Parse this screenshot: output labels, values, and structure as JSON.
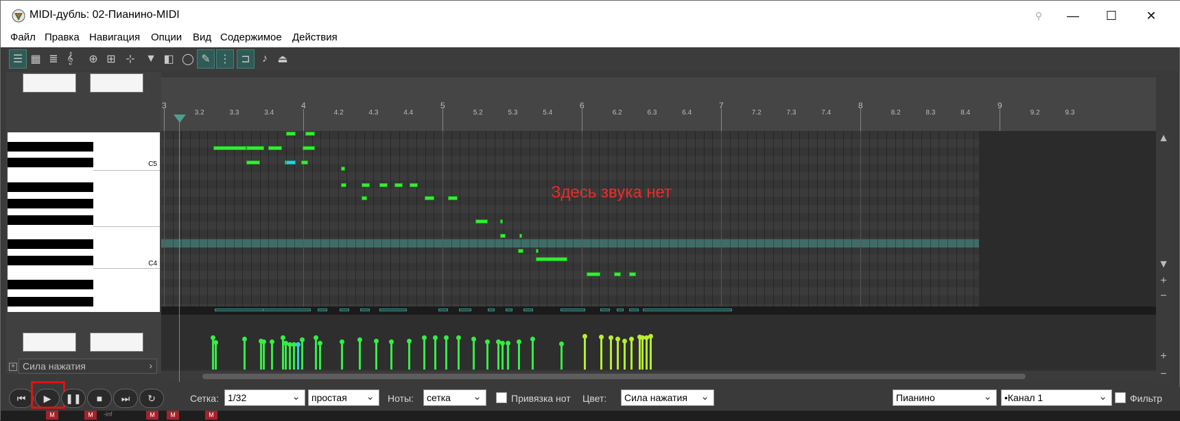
{
  "window": {
    "title": "MIDI-дубль: 02-Пианино-MIDI",
    "pin_icon": "pin-icon",
    "minimize_icon": "minimize-icon",
    "maximize_icon": "maximize-icon",
    "close_icon": "close-icon"
  },
  "menu": [
    {
      "label": "Файл"
    },
    {
      "label": "Правка"
    },
    {
      "label": "Навигация"
    },
    {
      "label": "Опции"
    },
    {
      "label": "Вид"
    },
    {
      "label": "Содержимое"
    },
    {
      "label": "Действия"
    }
  ],
  "toolbar": [
    {
      "icon": "piano-roll-icon",
      "active": true
    },
    {
      "icon": "drum-grid-icon",
      "active": false
    },
    {
      "icon": "event-list-icon",
      "active": false
    },
    {
      "icon": "treble-clef-icon",
      "active": false
    },
    {
      "icon": "insert-cc-icon",
      "active": false
    },
    {
      "icon": "lane-edit-icon",
      "active": false
    },
    {
      "icon": "move-icon",
      "active": false
    },
    {
      "icon": "filter-icon",
      "active": false
    },
    {
      "icon": "panel-toggle-icon",
      "active": false
    },
    {
      "icon": "lasso-icon",
      "active": false
    },
    {
      "icon": "draw-icon",
      "active": true
    },
    {
      "icon": "grid-dots-icon",
      "active": true
    },
    {
      "icon": "snap-icon",
      "active": true
    },
    {
      "icon": "step-input-icon",
      "active": false
    },
    {
      "icon": "record-settings-icon",
      "active": false
    }
  ],
  "keyboard": {
    "c5_label": "C5",
    "c4_label": "C4"
  },
  "velocity_lane": {
    "label": "Сила нажатия"
  },
  "grid": {
    "message": "Здесь звука нет"
  },
  "ruler": {
    "labels": [
      "3",
      "3.2",
      "3.3",
      "3.4",
      "4",
      "4.2",
      "4.3",
      "4.4",
      "5",
      "5.2",
      "5.3",
      "5.4",
      "6",
      "6.2",
      "6.3",
      "6.4",
      "7",
      "7.2",
      "7.3",
      "7.4",
      "8",
      "8.2",
      "8.3",
      "8.4",
      "9",
      "9.2",
      "9.3"
    ],
    "major": [
      "3",
      "4",
      "5",
      "6",
      "7",
      "8",
      "9"
    ]
  },
  "transport": {
    "buttons": [
      "skip-back-icon",
      "play-icon",
      "pause-icon",
      "stop-icon",
      "skip-forward-icon",
      "loop-icon"
    ],
    "grid_label": "Сетка:",
    "grid_value": "1/32",
    "swing_value": "простая",
    "notes_label": "Ноты:",
    "notes_value": "сетка",
    "snap_label": "Привязка нот",
    "color_label": "Цвет:",
    "color_value": "Сила нажатия",
    "instrument_value": "Пианино",
    "channel_value": "•Канал 1",
    "filter_label": "Фильтр"
  },
  "bottom_strip": {
    "mute_labels": [
      "M",
      "M",
      "M",
      "M",
      "M",
      "M"
    ],
    "db_label": "-inf"
  },
  "colors": {
    "note": "#33ee33",
    "selected_note": "#24d4e0",
    "message": "#ee2b2b",
    "play_highlight": "#e01212"
  }
}
